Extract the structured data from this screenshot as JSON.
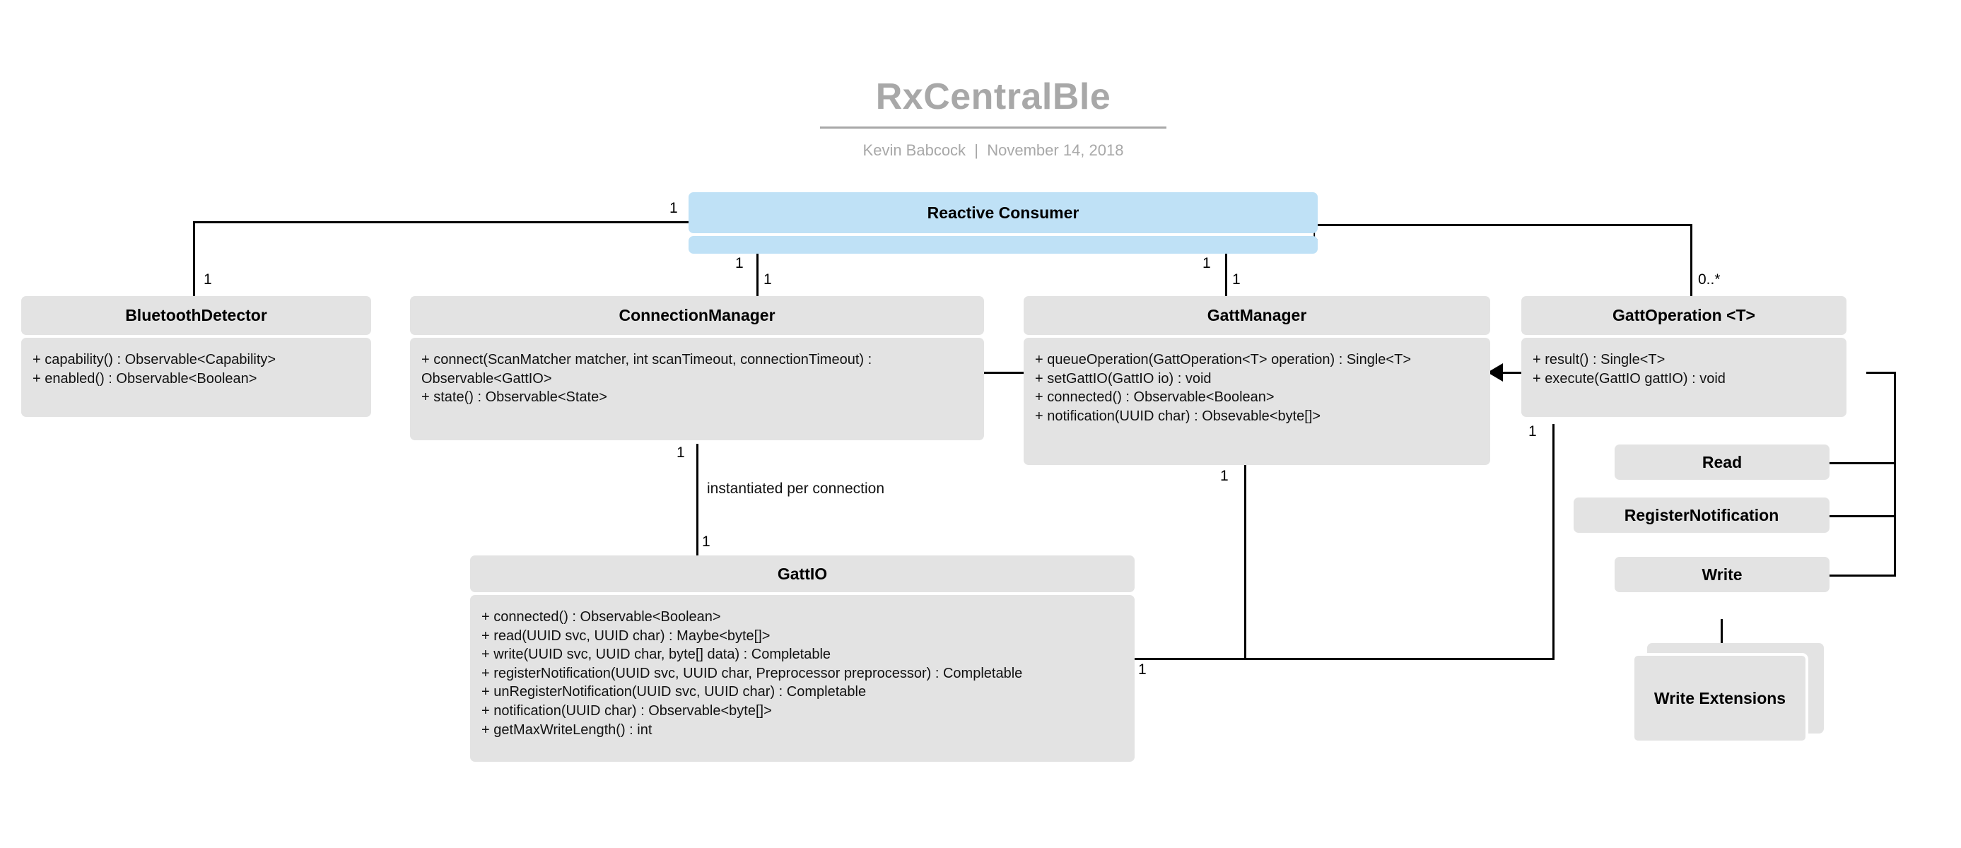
{
  "deck": {
    "title": "RxCentralBle",
    "subtitle": "Kevin Babcock  |  November 14, 2018"
  },
  "colors": {
    "box_fill": "#e3e3e3",
    "consumer_fill": "#bfe1f6",
    "title_gray": "#a8a8a8",
    "line": "#000000",
    "page_background": "#ffffff"
  },
  "classes": {
    "reactive_consumer": {
      "name": "Reactive Consumer",
      "members": []
    },
    "bluetooth_detector": {
      "name": "BluetoothDetector",
      "members": [
        "+ capability() : Observable<Capability>",
        "+ enabled() : Observable<Boolean>"
      ]
    },
    "connection_manager": {
      "name": "ConnectionManager",
      "members": [
        "+ connect(ScanMatcher matcher, int scanTimeout, connectionTimeout) : Observable<GattIO>",
        "+ state() : Observable<State>"
      ]
    },
    "gatt_manager": {
      "name": "GattManager",
      "members": [
        "+ queueOperation(GattOperation<T> operation) : Single<T>",
        "+ setGattIO(GattIO io) : void",
        "+ connected() : Observable<Boolean>",
        "+ notification(UUID char) : Obsevable<byte[]>"
      ]
    },
    "gatt_operation": {
      "name": "GattOperation <T>",
      "members": [
        "+ result() : Single<T>",
        "+ execute(GattIO gattIO) : void"
      ]
    },
    "gatt_io": {
      "name": "GattIO",
      "members": [
        "+ connected() : Observable<Boolean>",
        "+ read(UUID svc, UUID char) : Maybe<byte[]>",
        "+ write(UUID svc, UUID char, byte[] data) : Completable",
        "+ registerNotification(UUID svc, UUID char, Preprocessor preprocessor) : Completable",
        "+ unRegisterNotification(UUID svc, UUID char) : Completable",
        "+ notification(UUID char) : Observable<byte[]>",
        "+ getMaxWriteLength() : int"
      ]
    },
    "read": {
      "name": "Read"
    },
    "register_notification": {
      "name": "RegisterNotification"
    },
    "write": {
      "name": "Write"
    },
    "write_extensions": {
      "name": "Write Extensions"
    }
  },
  "multiplicities": {
    "consumer_left": "1",
    "consumer_right": "1",
    "consumer_to_connection_manager": "1",
    "consumer_to_gatt_manager": "1",
    "bluetooth_detector_end": "1",
    "connection_manager_end": "1",
    "gatt_manager_end": "1",
    "gatt_operation_end": "0..*",
    "connection_manager_to_gattio_top": "1",
    "connection_manager_to_gattio_bottom": "1",
    "gatt_manager_to_gattio": "1",
    "gatt_operation_to_gattio": "1",
    "gattio_right": "1"
  },
  "notes": {
    "instantiated_per_connection": "instantiated per connection"
  }
}
